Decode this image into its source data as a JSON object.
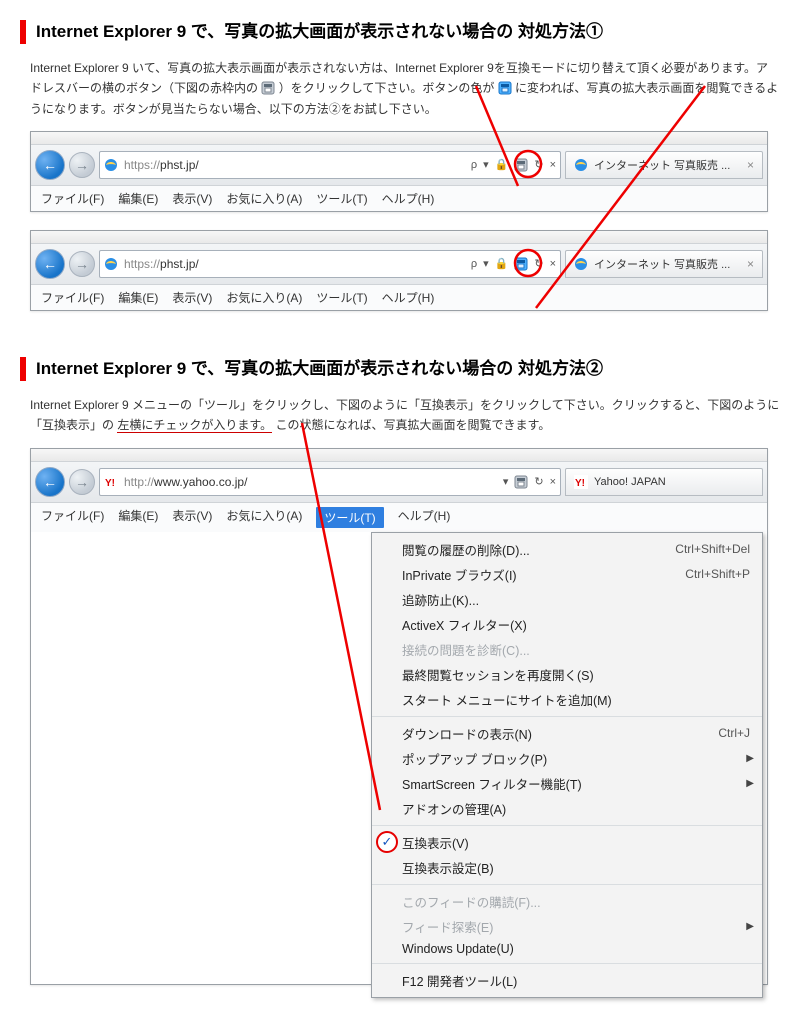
{
  "section1": {
    "title": "Internet Explorer 9 で、写真の拡大画面が表示されない場合の 対処方法①",
    "text_a": "Internet Explorer 9 いて、写真の拡大表示画面が表示されない方は、Internet Explorer 9を互換モードに切り替えて頂く必要があります。アドレスバーの横のボタン（下図の赤枠内の",
    "text_b": "）をクリックして下さい。ボタンの色が ",
    "text_c": "に変われば、写真の拡大表示画面を閲覧できるようになります。ボタンが見当たらない場合、以下の方法②をお試し下さい。"
  },
  "ie1": {
    "url_proto": "https://",
    "url_host": "phst.jp/",
    "search_hint": "ρ",
    "tab_label": "インターネット 写真販売 ...",
    "menu": {
      "file": "ファイル(F)",
      "edit": "編集(E)",
      "view": "表示(V)",
      "fav": "お気に入り(A)",
      "tools": "ツール(T)",
      "help": "ヘルプ(H)"
    }
  },
  "section2": {
    "title": "Internet Explorer 9 で、写真の拡大画面が表示されない場合の 対処方法②",
    "text_a": "Internet Explorer 9 メニューの「ツール」をクリックし、下図のように「互換表示」をクリックして下さい。クリックすると、下図のように「互換表示」の",
    "text_u": "左横にチェックが入ります。",
    "text_b": "この状態になれば、写真拡大画面を閲覧できます。"
  },
  "ie2": {
    "url_proto": "http://",
    "url_host": "www.yahoo.co.jp/",
    "tab_label": "Yahoo! JAPAN",
    "menu": {
      "file": "ファイル(F)",
      "edit": "編集(E)",
      "view": "表示(V)",
      "fav": "お気に入り(A)",
      "tools": "ツール(T)",
      "help": "ヘルプ(H)"
    },
    "drop": {
      "g1a": "閲覧の履歴の削除(D)...",
      "g1a_s": "Ctrl+Shift+Del",
      "g1b": "InPrivate ブラウズ(I)",
      "g1b_s": "Ctrl+Shift+P",
      "g1c": "追跡防止(K)...",
      "g1d": "ActiveX フィルター(X)",
      "g1e": "接続の問題を診断(C)...",
      "g1f": "最終閲覧セッションを再度開く(S)",
      "g1g": "スタート メニューにサイトを追加(M)",
      "g2a": "ダウンロードの表示(N)",
      "g2a_s": "Ctrl+J",
      "g2b": "ポップアップ ブロック(P)",
      "g2c": "SmartScreen フィルター機能(T)",
      "g2d": "アドオンの管理(A)",
      "g3a": "互換表示(V)",
      "g3b": "互換表示設定(B)",
      "g4a": "このフィードの購読(F)...",
      "g4b": "フィード探索(E)",
      "g4c": "Windows Update(U)",
      "g5a": "F12 開発者ツール(L)"
    }
  }
}
